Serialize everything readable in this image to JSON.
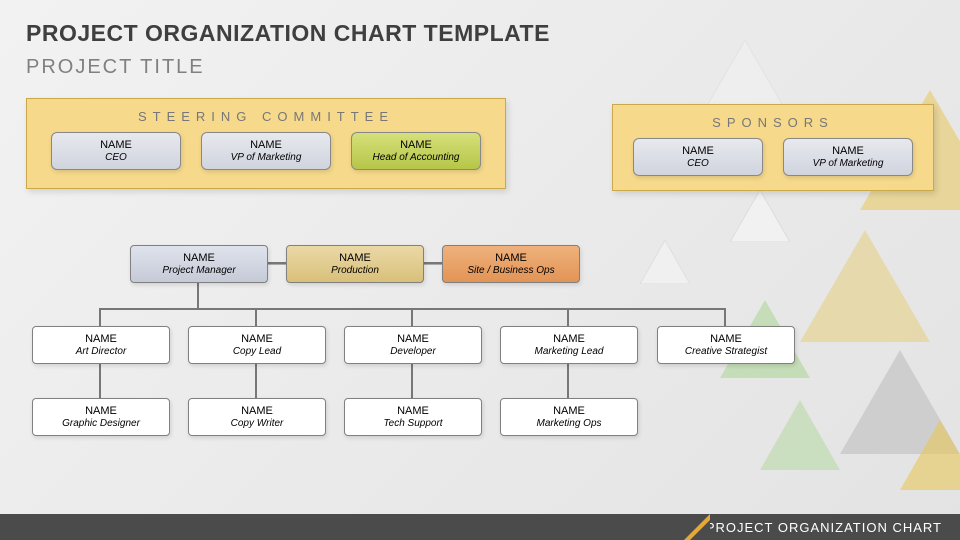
{
  "title_main": "PROJECT ORGANIZATION CHART TEMPLATE",
  "title_sub": "PROJECT TITLE",
  "footer_text": "PROJECT ORGANIZATION CHART",
  "panels": {
    "steering": {
      "title": "STEERING COMMITTEE",
      "cards": [
        {
          "name": "NAME",
          "role": "CEO",
          "variant": "blue"
        },
        {
          "name": "NAME",
          "role": "VP of Marketing",
          "variant": "blue"
        },
        {
          "name": "NAME",
          "role": "Head of Accounting",
          "variant": "green"
        }
      ]
    },
    "sponsors": {
      "title": "SPONSORS",
      "cards": [
        {
          "name": "NAME",
          "role": "CEO",
          "variant": "blue"
        },
        {
          "name": "NAME",
          "role": "VP of Marketing",
          "variant": "blue"
        }
      ]
    }
  },
  "org": {
    "leaders": [
      {
        "name": "NAME",
        "role": "Project Manager",
        "variant": "blue"
      },
      {
        "name": "NAME",
        "role": "Production",
        "variant": "tan"
      },
      {
        "name": "NAME",
        "role": "Site / Business Ops",
        "variant": "orange"
      }
    ],
    "row_mid": [
      {
        "name": "NAME",
        "role": "Art Director"
      },
      {
        "name": "NAME",
        "role": "Copy Lead"
      },
      {
        "name": "NAME",
        "role": "Developer"
      },
      {
        "name": "NAME",
        "role": "Marketing Lead"
      },
      {
        "name": "NAME",
        "role": "Creative Strategist"
      }
    ],
    "row_bottom": [
      {
        "name": "NAME",
        "role": "Graphic Designer"
      },
      {
        "name": "NAME",
        "role": "Copy Writer"
      },
      {
        "name": "NAME",
        "role": "Tech Support"
      },
      {
        "name": "NAME",
        "role": "Marketing Ops"
      }
    ]
  }
}
